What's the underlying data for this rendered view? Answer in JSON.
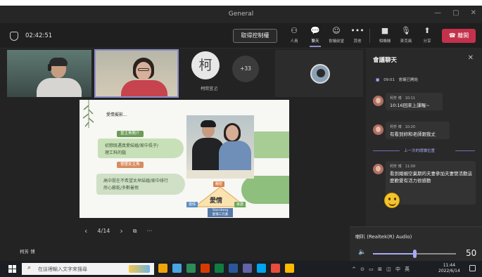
{
  "window": {
    "title": "General",
    "controls": [
      "—",
      "▢",
      "✕"
    ]
  },
  "meeting": {
    "elapsed": "02:42:51",
    "take_control_label": "取得控制權",
    "toolbar": [
      {
        "icon": "people-icon",
        "glyph": "⚇",
        "label": "人員"
      },
      {
        "icon": "chat-icon",
        "glyph": "💬",
        "label": "聊天",
        "active": true
      },
      {
        "icon": "reactions-icon",
        "glyph": "☺",
        "label": "會議前堂"
      },
      {
        "icon": "more-icon",
        "glyph": "•••",
        "label": "其他"
      },
      {
        "icon": "camera-icon",
        "glyph": "■",
        "label": "相機機"
      },
      {
        "icon": "mic-off-icon",
        "glyph": "🎙",
        "label": "麥克風"
      },
      {
        "icon": "share-icon",
        "glyph": "⬆",
        "label": "分享"
      }
    ],
    "leave_label": "離開",
    "accent": "#8b8cc7",
    "leave_color": "#c4314b"
  },
  "gallery": {
    "avatar_initial": "柯",
    "avatar_name": "柯欣宜",
    "overflow_count": "+33"
  },
  "slide": {
    "heading": "愛情擬影...",
    "tag1": "當主角簡介",
    "pill1_lines": [
      "初戀既遇真愛結婚/家中長子/",
      "理工科的腦"
    ],
    "tag2": "晉證女主角",
    "pill2_lines": [
      "高中挺在不希望太早結婚/家中排行",
      "房心蔽乾/多數暑假"
    ],
    "triangle": {
      "top": "親密",
      "left": "激情",
      "right": "承諾",
      "center": "愛情",
      "base_lines": [
        "Sternberg",
        "愛情三元素"
      ]
    },
    "page": "4/14"
  },
  "presenter_name": "柯芳 博",
  "chat": {
    "title": "會議聊天",
    "meeting_started_time": "09:01",
    "meeting_started_text": "會議已開始",
    "messages": [
      {
        "sender": "柯芳 博",
        "time": "10:11",
        "text": "10:16回來上課喔~"
      },
      {
        "sender": "柯芳 博",
        "time": "10:20",
        "text": "有看到妳和老師跟我丈"
      }
    ],
    "divider_text": "上一次的閱讀位置",
    "last_message": {
      "sender": "柯芳 博",
      "time": "11:09",
      "text": "看到婚姻空巢期的夫妻參加夫妻營活動這麼歡愛有活力很感動"
    }
  },
  "volume": {
    "device": "喇叭 (Realtek(R) Audio)",
    "level": 50
  },
  "taskbar": {
    "search_placeholder": "在這裡輸入文字來搜尋",
    "tray_text": "^ ⊙ ▭ ⊞ ◫ 中 英",
    "time": "11:44",
    "date": "2022/6/14",
    "app_colors": [
      "#f0a30a",
      "#4aa5e0",
      "#2e8b57",
      "#d83b01",
      "#107c41",
      "#2b579a",
      "#6264a7",
      "#00a4ef",
      "#e74c3c",
      "#ffb900"
    ]
  }
}
